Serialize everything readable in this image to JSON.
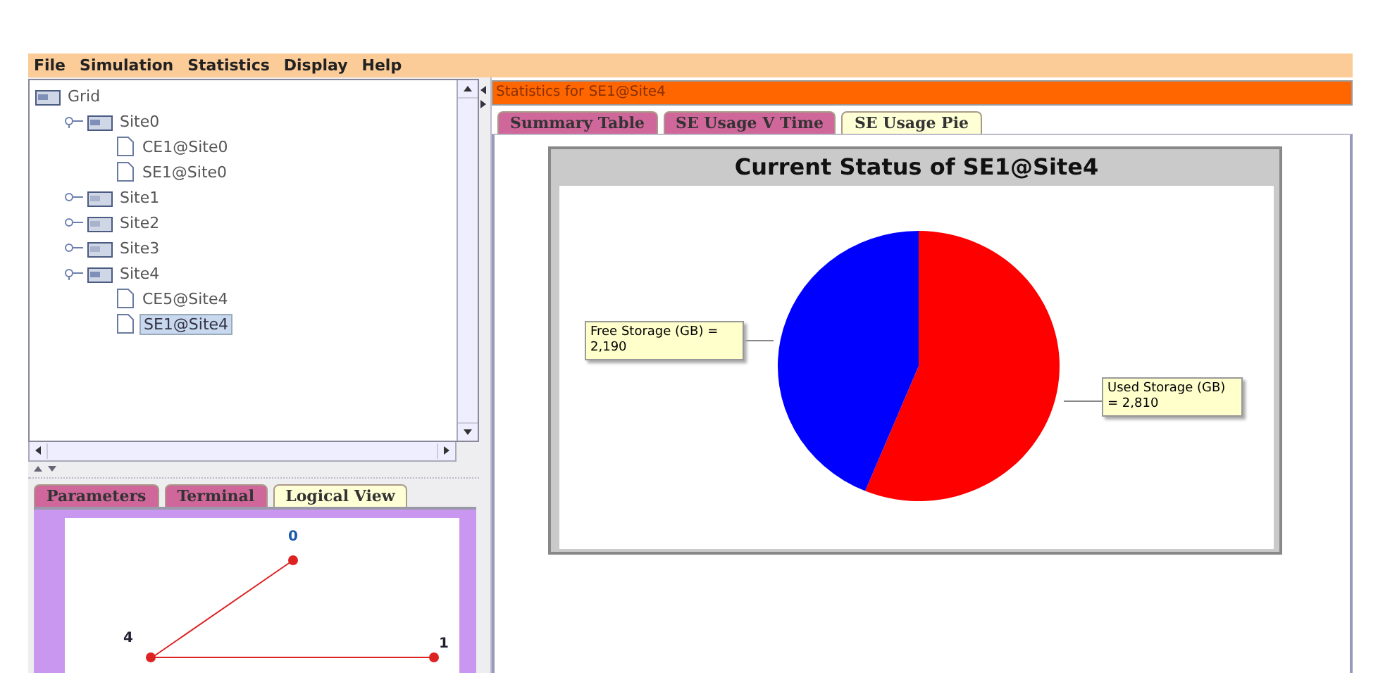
{
  "menu": [
    "File",
    "Simulation",
    "Statistics",
    "Display",
    "Help"
  ],
  "tree": {
    "label": "Grid",
    "expanded": true,
    "selected": false,
    "children": [
      {
        "label": "Site0",
        "expanded": true,
        "selected": false,
        "children": [
          {
            "label": "CE1@Site0",
            "selected": false
          },
          {
            "label": "SE1@Site0",
            "selected": false
          }
        ]
      },
      {
        "label": "Site1",
        "expanded": false,
        "selected": false
      },
      {
        "label": "Site2",
        "expanded": false,
        "selected": false
      },
      {
        "label": "Site3",
        "expanded": false,
        "selected": false
      },
      {
        "label": "Site4",
        "expanded": true,
        "selected": false,
        "children": [
          {
            "label": "CE5@Site4",
            "selected": false
          },
          {
            "label": "SE1@Site4",
            "selected": true
          }
        ]
      }
    ]
  },
  "bottom_tabs": [
    {
      "label": "Parameters",
      "selected": false
    },
    {
      "label": "Terminal",
      "selected": false
    },
    {
      "label": "Logical View",
      "selected": true
    }
  ],
  "logical_view": {
    "nodes": [
      "0",
      "4",
      "1"
    ]
  },
  "stats_panel": {
    "title": "Statistics for SE1@Site4",
    "tabs": [
      {
        "label": "Summary Table",
        "selected": false
      },
      {
        "label": "SE Usage V Time",
        "selected": false
      },
      {
        "label": "SE Usage Pie",
        "selected": true
      }
    ],
    "chart_data": {
      "type": "pie",
      "title": "Current Status of SE1@Site4",
      "categories": [
        "Used Storage (GB)",
        "Free Storage (GB)"
      ],
      "values": [
        2810,
        2190
      ],
      "value_labels": [
        "= 2,810",
        "= 2,190"
      ],
      "colors": [
        "#ff0000",
        "#0000ff"
      ]
    }
  }
}
